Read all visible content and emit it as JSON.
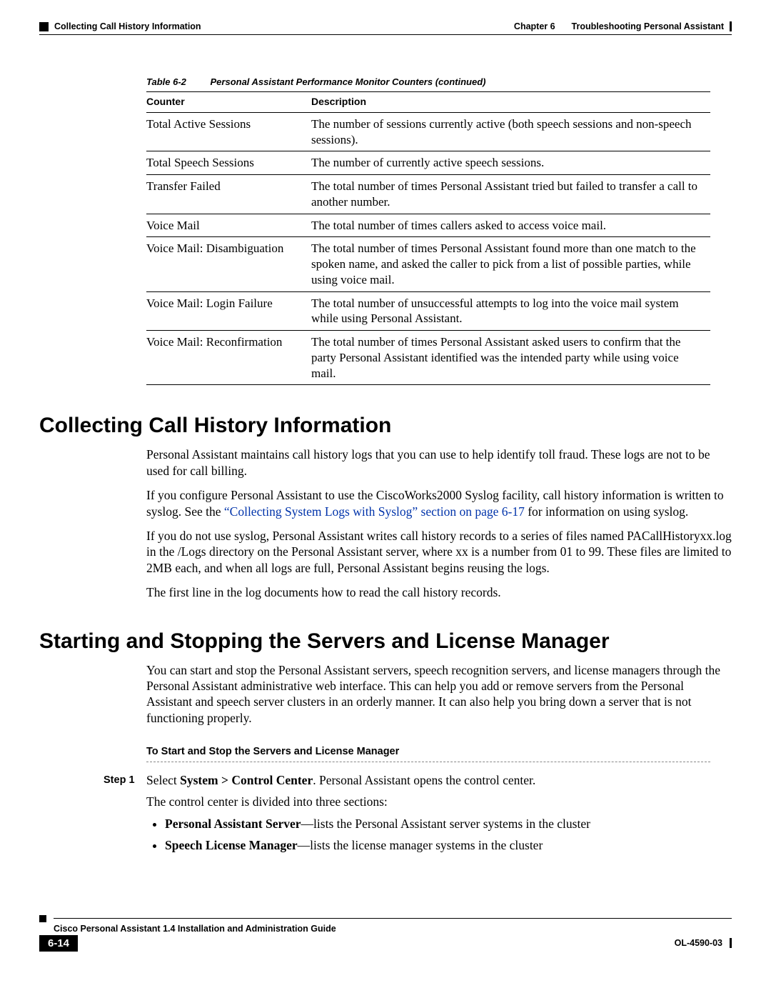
{
  "header": {
    "section_left": "Collecting Call History Information",
    "chapter_label": "Chapter 6",
    "chapter_title": "Troubleshooting Personal Assistant"
  },
  "table": {
    "number": "Table 6-2",
    "title": "Personal Assistant Performance Monitor Counters (continued)",
    "columns": {
      "c1": "Counter",
      "c2": "Description"
    },
    "rows": [
      {
        "counter": "Total Active Sessions",
        "desc": "The number of sessions currently active (both speech sessions and non-speech sessions)."
      },
      {
        "counter": "Total Speech Sessions",
        "desc": "The number of currently active speech sessions."
      },
      {
        "counter": "Transfer Failed",
        "desc": "The total number of times Personal Assistant tried but failed to transfer a call to another number."
      },
      {
        "counter": "Voice Mail",
        "desc": "The total number of times callers asked to access voice mail."
      },
      {
        "counter": "Voice Mail: Disambiguation",
        "desc": "The total number of times Personal Assistant found more than one match to the spoken name, and asked the caller to pick from a list of possible parties, while using voice mail."
      },
      {
        "counter": "Voice Mail: Login Failure",
        "desc": "The total number of unsuccessful attempts to log into the voice mail system while using Personal Assistant."
      },
      {
        "counter": "Voice Mail: Reconfirmation",
        "desc": "The total number of times Personal Assistant asked users to confirm that the party Personal Assistant identified was the intended party while using voice mail."
      }
    ]
  },
  "section1": {
    "heading": "Collecting Call History Information",
    "p1": "Personal Assistant maintains call history logs that you can use to help identify toll fraud. These logs are not to be used for call billing.",
    "p2a": "If you configure Personal Assistant to use the CiscoWorks2000 Syslog facility, call history information is written to syslog. See the ",
    "p2link": "“Collecting System Logs with Syslog” section on page 6-17",
    "p2b": " for information on using syslog.",
    "p3": "If you do not use syslog, Personal Assistant writes call history records to a series of files named PACallHistoryxx.log in the /Logs directory on the Personal Assistant server, where xx is a number from 01 to 99. These files are limited to 2MB each, and when all logs are full, Personal Assistant begins reusing the logs.",
    "p4": "The first line in the log documents how to read the call history records."
  },
  "section2": {
    "heading": "Starting and Stopping the Servers and License Manager",
    "p1": "You can start and stop the Personal Assistant servers, speech recognition servers, and license managers through the Personal Assistant administrative web interface. This can help you add or remove servers from the Personal Assistant and speech server clusters in an orderly manner. It can also help you bring down a server that is not functioning properly.",
    "subhead": "To Start and Stop the Servers and License Manager",
    "step1": {
      "label": "Step 1",
      "line1a": "Select ",
      "line1b": "System > Control Center",
      "line1c": ". Personal Assistant opens the control center.",
      "line2": "The control center is divided into three sections:",
      "bullet1a": "Personal Assistant Server",
      "bullet1b": "—lists the Personal Assistant server systems in the cluster",
      "bullet2a": "Speech License Manager",
      "bullet2b": "—lists the license manager systems in the cluster"
    }
  },
  "footer": {
    "guide_title": "Cisco Personal Assistant 1.4 Installation and Administration Guide",
    "page_number": "6-14",
    "doc_id": "OL-4590-03"
  }
}
